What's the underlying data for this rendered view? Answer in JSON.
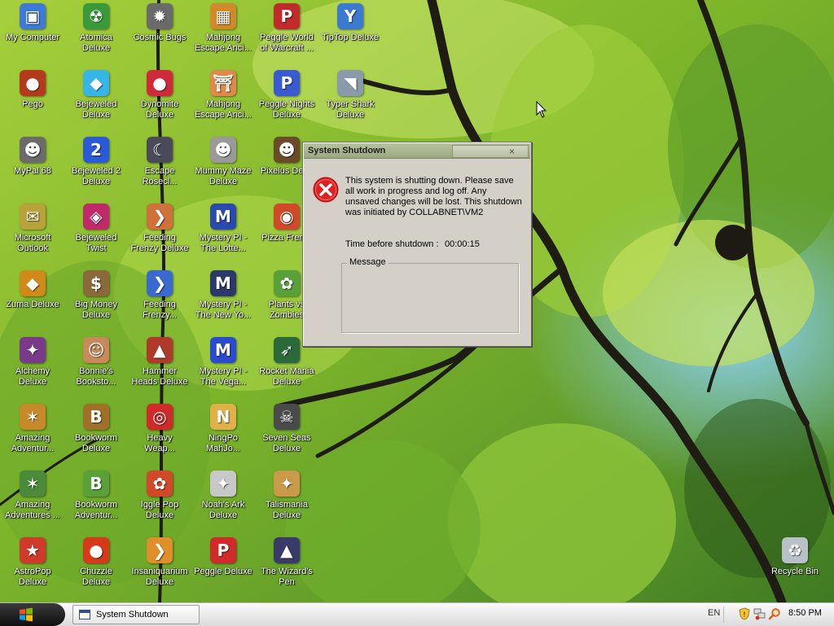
{
  "desktop": {
    "icons": [
      {
        "label": "My Computer",
        "icon": "computer-icon",
        "color": "#3d7ad6",
        "glyph": "▣"
      },
      {
        "label": "Pego",
        "icon": "pego-ball-icon",
        "color": "#b43a1e",
        "glyph": "●"
      },
      {
        "label": "MyPal 68",
        "icon": "raccoon-icon",
        "color": "#6b6b6b",
        "glyph": "☻"
      },
      {
        "label": "Microsoft\nOutlook",
        "icon": "outlook-icon",
        "color": "#b8a23a",
        "glyph": "✉"
      },
      {
        "label": "Zuma Deluxe",
        "icon": "zuma-frog-icon",
        "color": "#d08a1a",
        "glyph": "◆"
      },
      {
        "label": "Alchemy\nDeluxe",
        "icon": "wizard-icon",
        "color": "#7a3a8a",
        "glyph": "✦"
      },
      {
        "label": "Amazing\nAdventur...",
        "icon": "compass-icon",
        "color": "#c78a2a",
        "glyph": "✶"
      },
      {
        "label": "Amazing\nAdventures ...",
        "icon": "globe-icon",
        "color": "#4a8a3a",
        "glyph": "✶"
      },
      {
        "label": "AstroPop\nDeluxe",
        "icon": "astropop-icon",
        "color": "#d03a2a",
        "glyph": "★"
      },
      {
        "label": "Atomica\nDeluxe",
        "icon": "atomica-icon",
        "color": "#3a9a3a",
        "glyph": "☢"
      },
      {
        "label": "Bejeweled\nDeluxe",
        "icon": "diamond-icon",
        "color": "#36b6e6",
        "glyph": "◆"
      },
      {
        "label": "Bejeweled 2\nDeluxe",
        "icon": "bejeweled2-icon",
        "color": "#2a5ad6",
        "glyph": "2"
      },
      {
        "label": "Bejeweled\nTwist",
        "icon": "bejeweled-twist-icon",
        "color": "#c02a6a",
        "glyph": "◈"
      },
      {
        "label": "Big Money\nDeluxe",
        "icon": "money-bag-icon",
        "color": "#8a6a3a",
        "glyph": "$"
      },
      {
        "label": "Bonnie's\nBooksto...",
        "icon": "bonnie-icon",
        "color": "#c88a5a",
        "glyph": "☺"
      },
      {
        "label": "Bookworm\nDeluxe",
        "icon": "bookworm-icon",
        "color": "#a0702a",
        "glyph": "B"
      },
      {
        "label": "Bookworm\nAdventur...",
        "icon": "bookworm-adventure-icon",
        "color": "#5aa03a",
        "glyph": "B"
      },
      {
        "label": "Chuzzle\nDeluxe",
        "icon": "chuzzle-icon",
        "color": "#d63a1a",
        "glyph": "●"
      },
      {
        "label": "Cosmic Bugs",
        "icon": "cosmic-bugs-icon",
        "color": "#6a6a6a",
        "glyph": "✹"
      },
      {
        "label": "Dynomite\nDeluxe",
        "icon": "dynomite-egg-icon",
        "color": "#d02a3a",
        "glyph": "●"
      },
      {
        "label": "Escape\nRosecl...",
        "icon": "moon-icon",
        "color": "#4a4a5a",
        "glyph": "☾"
      },
      {
        "label": "Feeding\nFrenzy Deluxe",
        "icon": "fish-icon",
        "color": "#d0703a",
        "glyph": "❯"
      },
      {
        "label": "Feeding\nFrenzy...",
        "icon": "fish-2-icon",
        "color": "#3a6ad0",
        "glyph": "❯"
      },
      {
        "label": "Hammer\nHeads Deluxe",
        "icon": "gnome-icon",
        "color": "#b03a2a",
        "glyph": "▲"
      },
      {
        "label": "Heavy\nWeap...",
        "icon": "lifebuoy-icon",
        "color": "#d02a2a",
        "glyph": "◎"
      },
      {
        "label": "Iggle Pop\nDeluxe",
        "icon": "iggle-pop-icon",
        "color": "#d04a2a",
        "glyph": "✿"
      },
      {
        "label": "Insaniquarium\nDeluxe",
        "icon": "goldfish-icon",
        "color": "#e0902a",
        "glyph": "❯"
      },
      {
        "label": "Mahjong\nEscape Anci...",
        "icon": "mahjong-icon",
        "color": "#d08a2a",
        "glyph": "▦"
      },
      {
        "label": "Mahjong\nEscape Anci...",
        "icon": "mahjong-gate-icon",
        "color": "#e08a4a",
        "glyph": "⛩"
      },
      {
        "label": "Mummy Maze\nDeluxe",
        "icon": "mummy-icon",
        "color": "#9a9a9a",
        "glyph": "☻"
      },
      {
        "label": "Mystery PI -\nThe Lotte...",
        "icon": "mystery-pi-icon",
        "color": "#2a4ab0",
        "glyph": "M"
      },
      {
        "label": "Mystery PI -\nThe New Yo...",
        "icon": "mystery-pi-shield-icon",
        "color": "#2a3a6a",
        "glyph": "M"
      },
      {
        "label": "Mystery PI -\nThe Vega...",
        "icon": "mystery-pi-vegas-icon",
        "color": "#2a4ad0",
        "glyph": "M"
      },
      {
        "label": "NingPo\nMahJo...",
        "icon": "ningpo-icon",
        "color": "#e0b04a",
        "glyph": "N"
      },
      {
        "label": "Noah's Ark\nDeluxe",
        "icon": "dove-icon",
        "color": "#c8c8c8",
        "glyph": "✦"
      },
      {
        "label": "Peggle Deluxe",
        "icon": "peggle-icon",
        "color": "#d02a2a",
        "glyph": "P"
      },
      {
        "label": "Peggle World\nof Warcraft ...",
        "icon": "peggle-wow-icon",
        "color": "#c02a2a",
        "glyph": "P"
      },
      {
        "label": "Peggle Nights\nDeluxe",
        "icon": "peggle-nights-icon",
        "color": "#3a5ad0",
        "glyph": "P"
      },
      {
        "label": "Pixelus Del...",
        "icon": "pixelus-icon",
        "color": "#6a4a2a",
        "glyph": "☻"
      },
      {
        "label": "Pizza Fren...",
        "icon": "pizza-icon",
        "color": "#d04a2a",
        "glyph": "◉"
      },
      {
        "label": "Plants vs\nZombies",
        "icon": "plant-icon",
        "color": "#5aa03a",
        "glyph": "✿"
      },
      {
        "label": "Rocket Mania\nDeluxe",
        "icon": "rocket-icon",
        "color": "#2a6a3a",
        "glyph": "➶"
      },
      {
        "label": "Seven Seas\nDeluxe",
        "icon": "skull-icon",
        "color": "#4a4a4a",
        "glyph": "☠"
      },
      {
        "label": "Talismania\nDeluxe",
        "icon": "talismania-icon",
        "color": "#c89a4a",
        "glyph": "✦"
      },
      {
        "label": "The Wizard's\nPen",
        "icon": "wizard-hat-icon",
        "color": "#3a3a6a",
        "glyph": "▲"
      },
      {
        "label": "TipTop Deluxe",
        "icon": "cocktail-icon",
        "color": "#3a7ad0",
        "glyph": "Y"
      },
      {
        "label": "Typer Shark\nDeluxe",
        "icon": "shark-icon",
        "color": "#8a9aaa",
        "glyph": "◥"
      },
      {
        "label": "Recycle Bin",
        "icon": "recycle-bin-icon",
        "color": "#b8c0c8",
        "glyph": "♻"
      }
    ]
  },
  "dialog": {
    "title": "System Shutdown",
    "close_glyph": "×",
    "message": "This system is shutting down. Please save all work in progress and log off. Any unsaved changes will be lost. This shutdown was initiated by COLLABNET\\VM2",
    "time_label": "Time before shutdown :",
    "time_value": "00:00:15",
    "group_label": "Message",
    "error_glyph": "✕"
  },
  "taskbar": {
    "task_label": "System Shutdown",
    "language": "EN",
    "clock": "8:50 PM"
  }
}
